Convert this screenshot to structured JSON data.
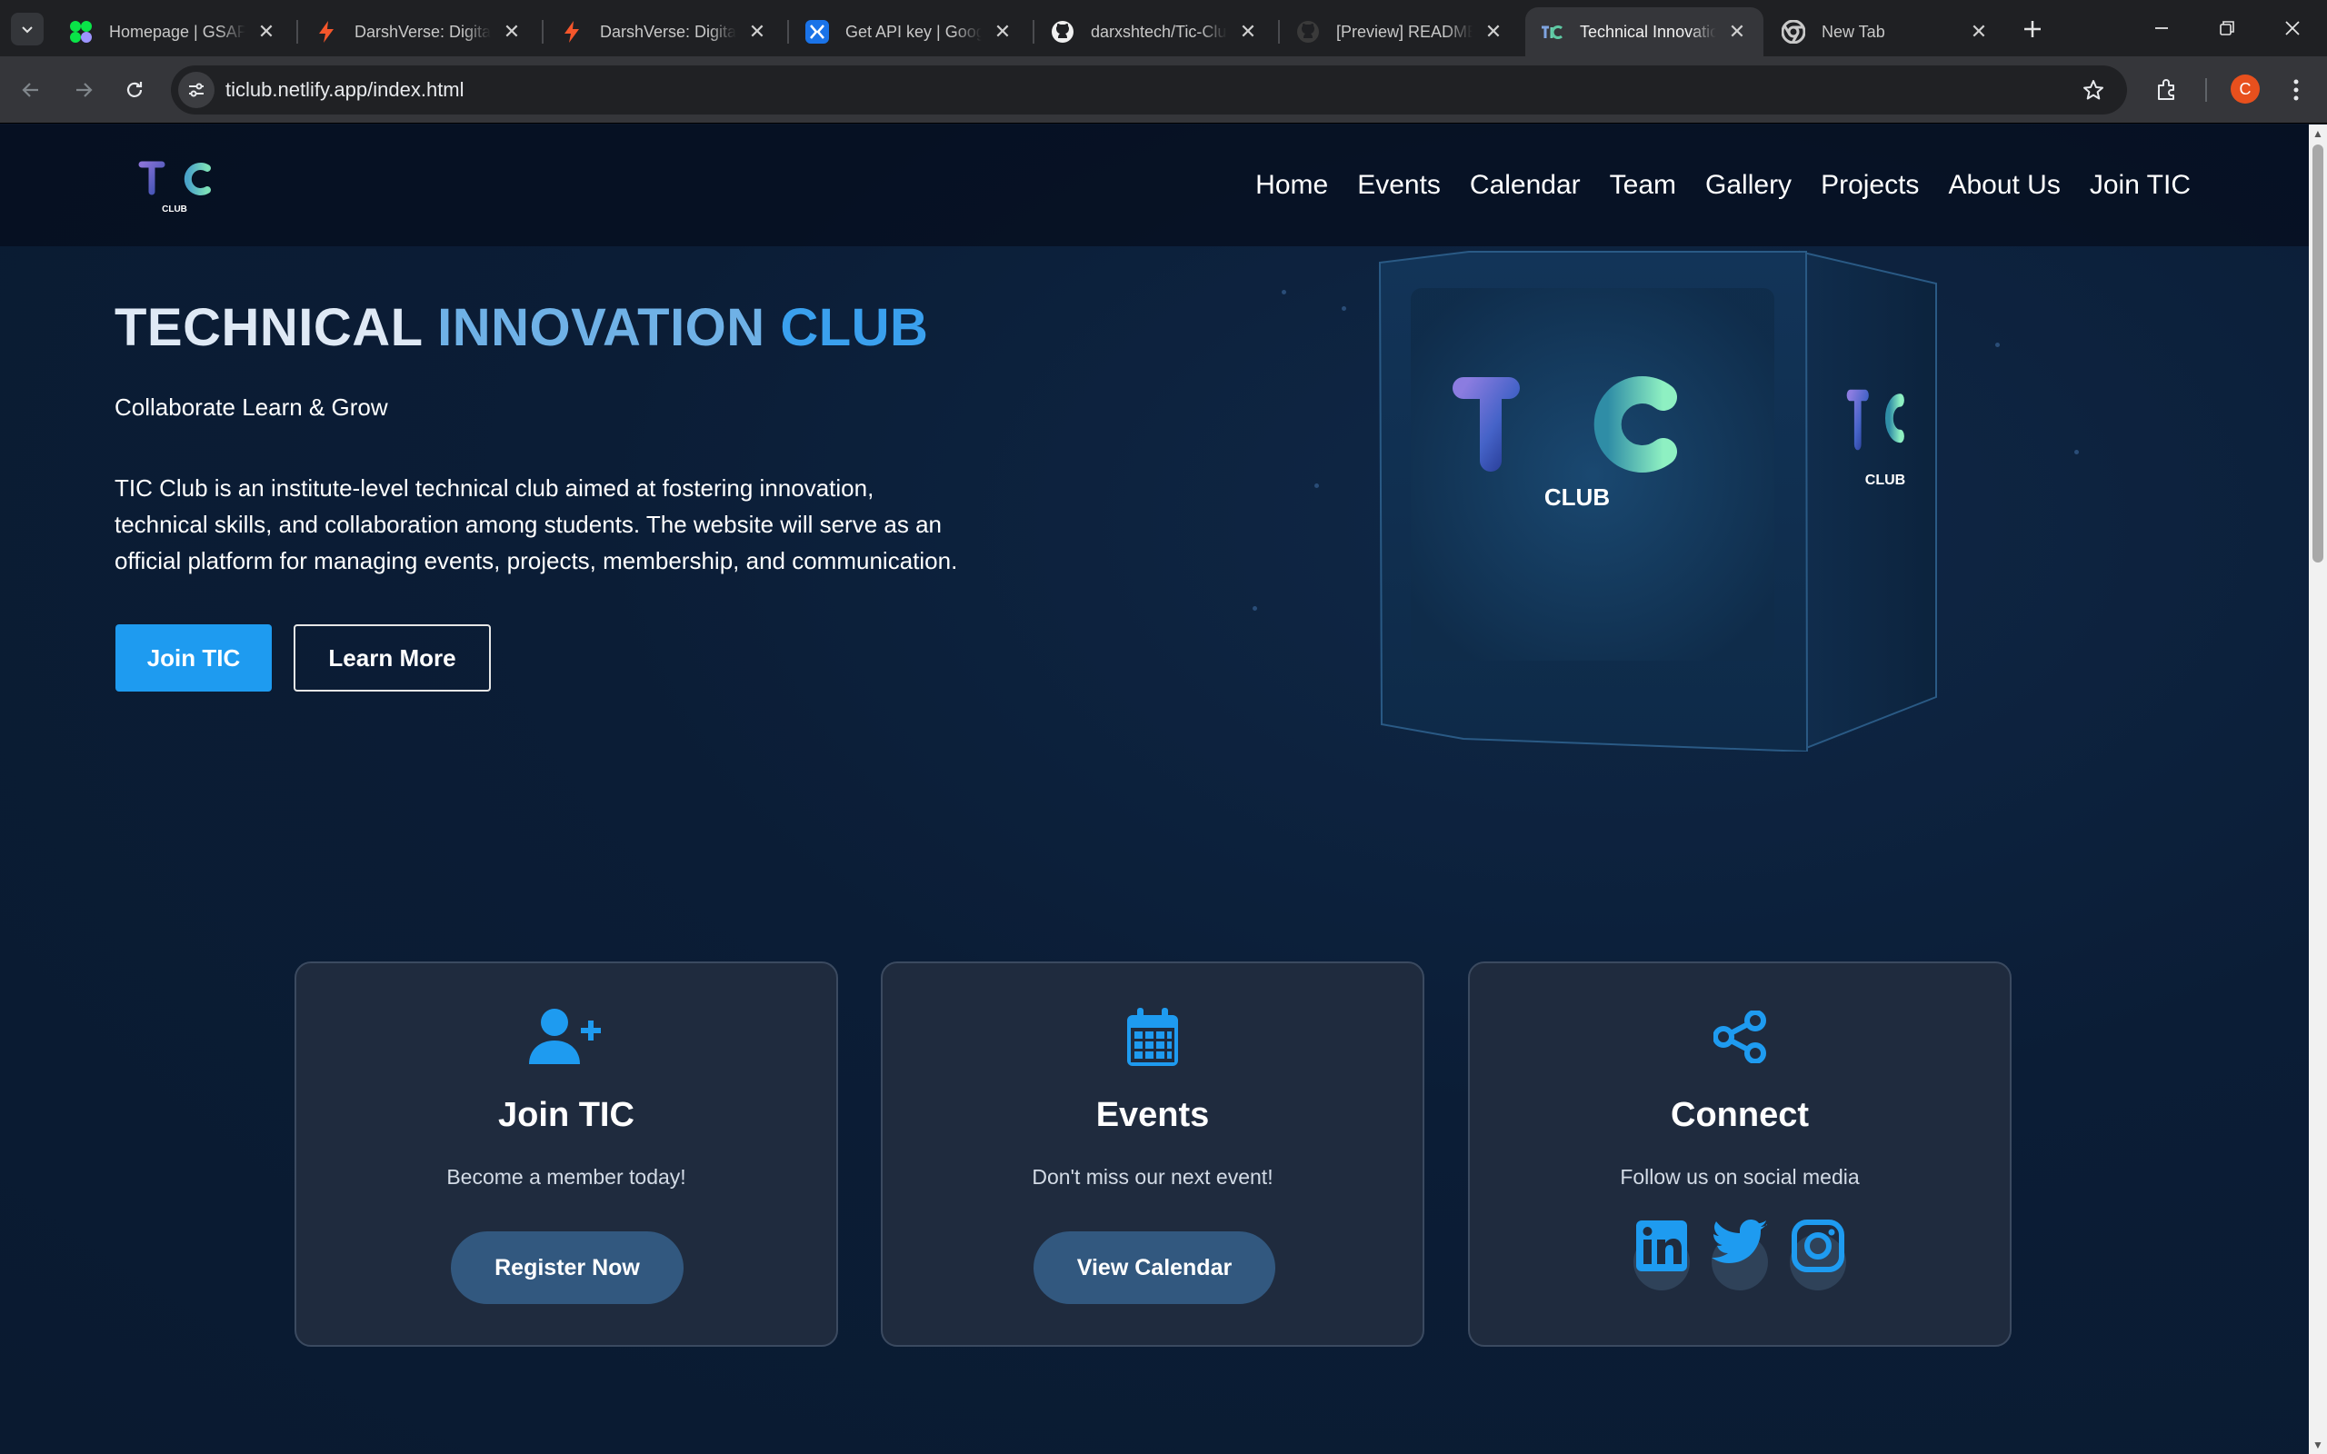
{
  "browser": {
    "tabs": [
      {
        "title": "Homepage | GSAP",
        "icon": "gsap-icon"
      },
      {
        "title": "DarshVerse: Digital V",
        "icon": "bolt-icon"
      },
      {
        "title": "DarshVerse: Digital V",
        "icon": "bolt-icon"
      },
      {
        "title": "Get API key | Google",
        "icon": "ai-studio-icon"
      },
      {
        "title": "darxshtech/Tic-Club",
        "icon": "github-icon"
      },
      {
        "title": "[Preview] README.m",
        "icon": "github-icon"
      },
      {
        "title": "Technical Innovation",
        "icon": "tic-icon",
        "active": true
      },
      {
        "title": "New Tab",
        "icon": "chrome-icon"
      }
    ],
    "url_host": "ticlub.netlify.app",
    "url_path": "/index.html",
    "profile_initial": "C"
  },
  "site": {
    "logo_text": "TIC",
    "logo_sub": "CLUB",
    "nav": [
      "Home",
      "Events",
      "Calendar",
      "Team",
      "Gallery",
      "Projects",
      "About Us",
      "Join TIC"
    ]
  },
  "hero": {
    "title_part1": "TECHNICAL",
    "title_part2": "INNOVATION",
    "title_part3": "CLUB",
    "tagline": "Collaborate Learn & Grow",
    "description": "TIC Club is an institute-level technical club aimed at fostering innovation, technical skills, and collaboration among students. The website will serve as an official platform for managing events, projects, membership, and communication.",
    "primary_button": "Join TIC",
    "secondary_button": "Learn More",
    "cube_label": "CLUB"
  },
  "cards": [
    {
      "icon": "user-plus-icon",
      "title": "Join TIC",
      "text": "Become a member today!",
      "button": "Register Now"
    },
    {
      "icon": "calendar-icon",
      "title": "Events",
      "text": "Don't miss our next event!",
      "button": "View Calendar"
    },
    {
      "icon": "share-icon",
      "title": "Connect",
      "text": "Follow us on social media",
      "socials": [
        "linkedin-icon",
        "twitter-icon",
        "instagram-icon"
      ]
    }
  ],
  "colors": {
    "accent": "#1e9bf0",
    "page_bg": "#0b1d36",
    "card_bg": "#1f2b3e",
    "card_button": "#32587f"
  }
}
